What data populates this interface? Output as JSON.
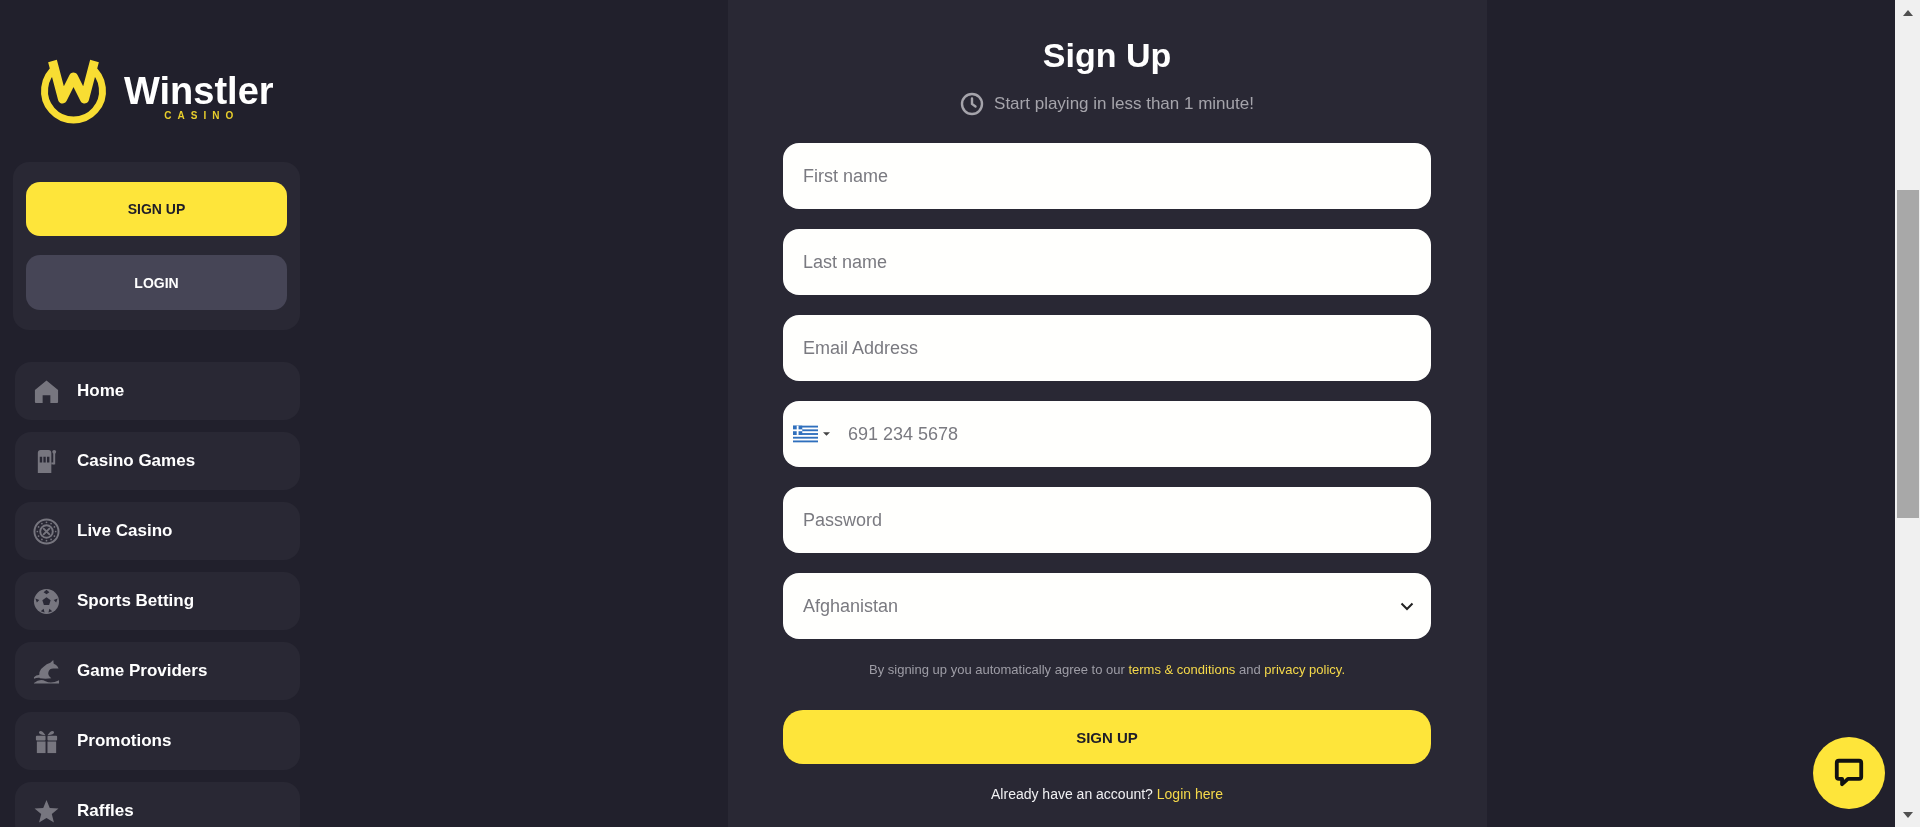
{
  "logo": {
    "name": "Winstler",
    "tagline": "CASINO"
  },
  "auth_buttons": [
    {
      "label": "SIGN UP",
      "kind": "primary"
    },
    {
      "label": "LOGIN",
      "kind": "secondary"
    }
  ],
  "sidebar": {
    "items": [
      {
        "label": "Home"
      },
      {
        "label": "Casino Games"
      },
      {
        "label": "Live Casino"
      },
      {
        "label": "Sports Betting"
      },
      {
        "label": "Game Providers"
      },
      {
        "label": "Promotions"
      },
      {
        "label": "Raffles"
      }
    ]
  },
  "signup_form": {
    "title": "Sign Up",
    "subtitle": "Start playing in less than 1 minute!",
    "fields": [
      {
        "kind": "name",
        "placeholder": "First name"
      },
      {
        "kind": "name",
        "placeholder": "Last name"
      },
      {
        "kind": "email",
        "placeholder": "Email Address"
      },
      {
        "kind": "phone",
        "placeholder": "691 234 5678"
      },
      {
        "kind": "password",
        "placeholder": "Password"
      },
      {
        "kind": "select",
        "value": "Afghanistan"
      }
    ],
    "terms": [
      {
        "kind": "text",
        "text": "By signing up you automatically agree to our"
      },
      {
        "kind": "link",
        "text": "terms & conditions"
      },
      {
        "kind": "text",
        "text": "and"
      },
      {
        "kind": "link",
        "text": "privacy policy."
      }
    ],
    "submit_button": "SIGN UP",
    "login_prompt": {
      "text": "Already have an account?",
      "link": "Login here"
    }
  }
}
